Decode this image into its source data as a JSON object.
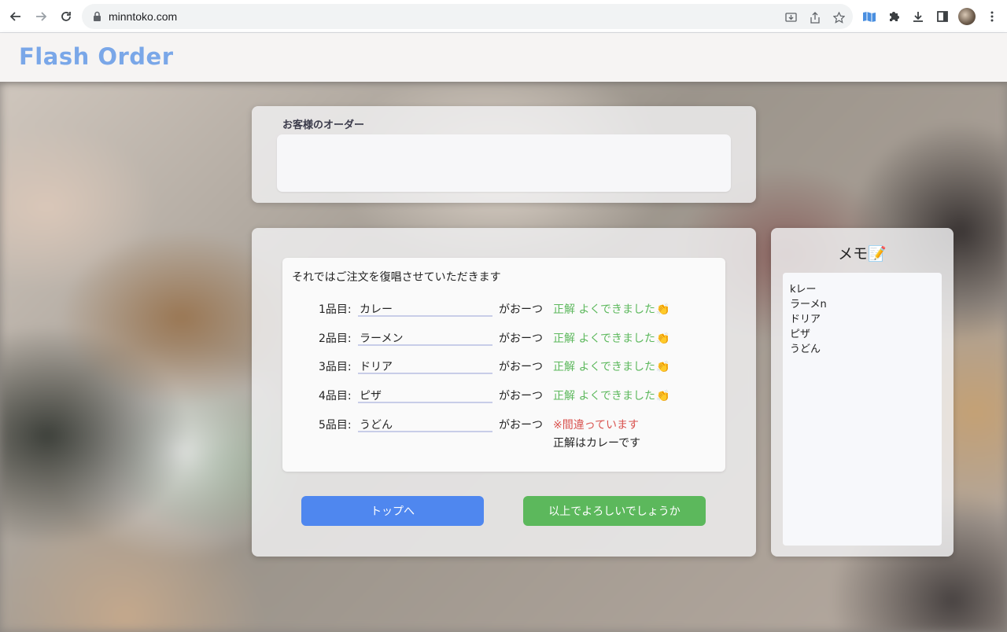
{
  "browser": {
    "url": "minntoko.com"
  },
  "app": {
    "title": "Flash Order"
  },
  "order": {
    "label": "お客様のオーダー",
    "text": ""
  },
  "confirm": {
    "title": "それではご注文を復唱させていただきます",
    "items": [
      {
        "label": "1品目:",
        "answer": "カレー",
        "suffix": "がおーつ",
        "result": "正解 よくできました",
        "correct": true
      },
      {
        "label": "2品目:",
        "answer": "ラーメン",
        "suffix": "がおーつ",
        "result": "正解 よくできました",
        "correct": true
      },
      {
        "label": "3品目:",
        "answer": "ドリア",
        "suffix": "がおーつ",
        "result": "正解 よくできました",
        "correct": true
      },
      {
        "label": "4品目:",
        "answer": "ピザ",
        "suffix": "がおーつ",
        "result": "正解 よくできました",
        "correct": true
      },
      {
        "label": "5品目:",
        "answer": "うどん",
        "suffix": "がおーつ",
        "result": "※間違っています",
        "correct": false,
        "correction": "正解はカレーです"
      }
    ]
  },
  "buttons": {
    "top": "トップへ",
    "confirm": "以上でよろしいでしょうか"
  },
  "memo": {
    "title": "メモ",
    "lines": [
      "kレー",
      "ラーメn",
      "ドリア",
      "ピザ",
      "うどん"
    ]
  },
  "colors": {
    "logo": "#7aa7e8",
    "correct": "#5cb85c",
    "wrong": "#d9534f",
    "primary_button": "#4f87ef",
    "success_button": "#5cb85c"
  }
}
